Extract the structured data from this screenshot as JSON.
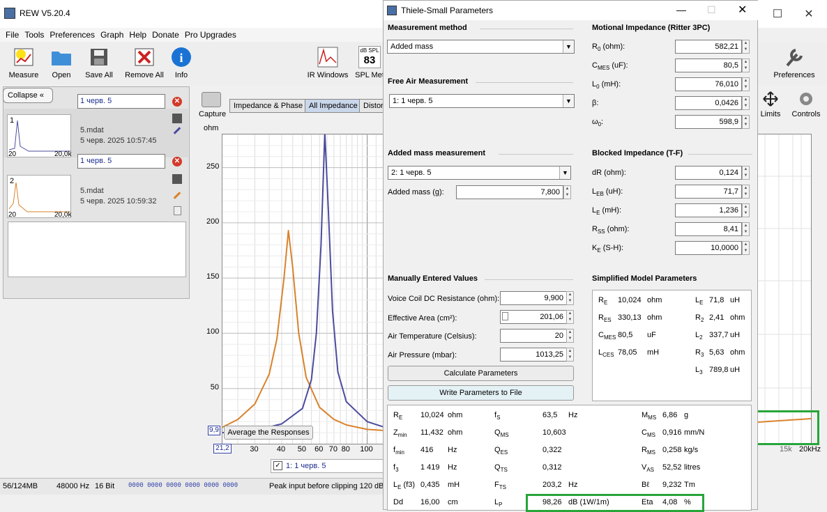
{
  "app": {
    "title": "REW V5.20.4",
    "menu": [
      "File",
      "Tools",
      "Preferences",
      "Graph",
      "Help",
      "Donate",
      "Pro Upgrades"
    ],
    "toolbar": {
      "measure": "Measure",
      "open": "Open",
      "save_all": "Save All",
      "remove_all": "Remove All",
      "info": "Info",
      "ir_windows": "IR Windows",
      "spl_meter": "SPL Met",
      "spl_meter_top": "dB SPL",
      "spl_meter_value": "83",
      "preferences": "Preferences",
      "limits": "Limits",
      "controls": "Controls"
    },
    "collapse": "Collapse",
    "capture": "Capture",
    "unit": "ohm",
    "tabs": [
      "Impedance & Phase",
      "All Impedance",
      "Distor"
    ],
    "measurements": [
      {
        "index": "1",
        "name": "1 черв. 5",
        "file": "5.mdat",
        "date": "5 черв. 2025 10:57:45",
        "thumb_x_min": "20",
        "thumb_x_max": "20,0k"
      },
      {
        "index": "2",
        "name": "1 черв. 5",
        "file": "5.mdat",
        "date": "5 черв. 2025 10:59:32",
        "thumb_x_min": "20",
        "thumb_x_max": "20,0k"
      }
    ],
    "average_btn": "Average the Responses",
    "legend_check": "1: 1 черв. 5",
    "graph_y_min": "9,9",
    "graph_x_min": "21,2",
    "right_x_ticks": [
      "15k",
      "20kHz"
    ],
    "status": {
      "mem": "56/124MB",
      "rate": "48000 Hz",
      "bits": "16 Bit",
      "bits_display": "0000 0000  0000 0000  0000 0000",
      "peak": "Peak input before clipping 120 dB"
    },
    "accent_orange": "#d9822b",
    "accent_blue": "#4b4b9e"
  },
  "chart_data": {
    "type": "line",
    "ylabel": "ohm",
    "yticks": [
      50,
      100,
      150,
      200,
      250
    ],
    "xticks": [
      "30",
      "40",
      "50",
      "60",
      "70",
      "80",
      "100"
    ],
    "ylim": [
      0,
      280
    ],
    "series": [
      {
        "color": "#d9822b",
        "x": [
          21.2,
          25,
          30,
          35,
          38,
          41,
          43,
          45,
          48,
          52,
          60,
          70,
          80,
          100,
          120
        ],
        "values": [
          15,
          22,
          36,
          63,
          95,
          150,
          193,
          160,
          100,
          60,
          33,
          22,
          17,
          13,
          12
        ]
      },
      {
        "color": "#4b4b9e",
        "x": [
          21.2,
          30,
          40,
          50,
          55,
          58,
          61,
          63.5,
          66,
          69,
          73,
          80,
          100,
          120
        ],
        "values": [
          10,
          12,
          18,
          32,
          58,
          100,
          180,
          282,
          210,
          120,
          65,
          38,
          20,
          15
        ]
      }
    ]
  },
  "dialog": {
    "title": "Thiele-Small Parameters",
    "measurement_method_label": "Measurement method",
    "measurement_method": "Added mass",
    "free_air_label": "Free Air Measurement",
    "free_air": "1: 1 черв. 5",
    "added_mass_meas_label": "Added mass measurement",
    "added_mass_meas": "2: 1 черв. 5",
    "added_mass_label": "Added mass (g):",
    "added_mass": "7,800",
    "motional_label": "Motional Impedance (Ritter 3PC)",
    "motional": [
      {
        "name": "R",
        "sub": "0",
        "unit": " (ohm):",
        "value": "582,21"
      },
      {
        "name": "C",
        "sub": "MES",
        "unit": " (uF):",
        "value": "80,5"
      },
      {
        "name": "L",
        "sub": "0",
        "unit": " (mH):",
        "value": "76,010"
      },
      {
        "name": "β",
        "sub": "",
        "unit": ":",
        "value": "0,0426"
      },
      {
        "name": "ω",
        "sub": "0",
        "unit": ":",
        "value": "598,9"
      }
    ],
    "blocked_label": "Blocked Impedance (T-F)",
    "blocked": [
      {
        "name": "dR",
        "sub": "",
        "unit": " (ohm):",
        "value": "0,124"
      },
      {
        "name": "L",
        "sub": "EB",
        "unit": " (uH):",
        "value": "71,7"
      },
      {
        "name": "L",
        "sub": "E",
        "unit": " (mH):",
        "value": "1,236"
      },
      {
        "name": "R",
        "sub": "SS",
        "unit": " (ohm):",
        "value": "8,41"
      },
      {
        "name": "K",
        "sub": "E",
        "unit": " (S-H):",
        "value": "10,0000"
      }
    ],
    "manual_label": "Manually Entered Values",
    "manual": [
      {
        "label": "Voice Coil DC Resistance (ohm):",
        "value": "9,900"
      },
      {
        "label": "Effective Area (cm²):",
        "value": "201,06"
      },
      {
        "label": "Air Temperature (Celsius):",
        "value": "20"
      },
      {
        "label": "Air Pressure (mbar):",
        "value": "1013,25"
      }
    ],
    "calc_btn": "Calculate Parameters",
    "write_btn": "Write Parameters to File",
    "simplified_label": "Simplified Model Parameters",
    "simplified_left": [
      {
        "name": "R",
        "sub": "E",
        "value": "10,024",
        "unit": "ohm"
      },
      {
        "name": "R",
        "sub": "ES",
        "value": "330,13",
        "unit": "ohm"
      },
      {
        "name": "C",
        "sub": "MES",
        "value": "80,5",
        "unit": "uF"
      },
      {
        "name": "L",
        "sub": "CES",
        "value": "78,05",
        "unit": "mH"
      }
    ],
    "simplified_right": [
      {
        "name": "L",
        "sub": "E",
        "value": "71,8",
        "unit": "uH"
      },
      {
        "name": "R",
        "sub": "2",
        "value": "2,41",
        "unit": "ohm"
      },
      {
        "name": "L",
        "sub": "2",
        "value": "337,7",
        "unit": "uH"
      },
      {
        "name": "R",
        "sub": "3",
        "value": "5,63",
        "unit": "ohm"
      },
      {
        "name": "L",
        "sub": "3",
        "value": "789,8",
        "unit": "uH"
      }
    ],
    "results": [
      [
        {
          "name": "R",
          "sub": "E",
          "value": "10,024",
          "unit": "ohm"
        },
        {
          "name": "f",
          "sub": "S",
          "value": "63,5",
          "unit": "Hz"
        },
        {
          "name": "M",
          "sub": "MS",
          "value": "6,86",
          "unit": "g"
        }
      ],
      [
        {
          "name": "Z",
          "sub": "min",
          "value": "11,432",
          "unit": "ohm"
        },
        {
          "name": "Q",
          "sub": "MS",
          "value": "10,603",
          "unit": ""
        },
        {
          "name": "C",
          "sub": "MS",
          "value": "0,916",
          "unit": "mm/N"
        }
      ],
      [
        {
          "name": "f",
          "sub": "min",
          "value": "416",
          "unit": "Hz"
        },
        {
          "name": "Q",
          "sub": "ES",
          "value": "0,322",
          "unit": ""
        },
        {
          "name": "R",
          "sub": "MS",
          "value": "0,258",
          "unit": "kg/s"
        }
      ],
      [
        {
          "name": "f",
          "sub": "3",
          "value": "1 419",
          "unit": "Hz"
        },
        {
          "name": "Q",
          "sub": "TS",
          "value": "0,312",
          "unit": ""
        },
        {
          "name": "V",
          "sub": "AS",
          "value": "52,52",
          "unit": "litres"
        }
      ],
      [
        {
          "name": "L",
          "sub": "E",
          "extra": " (f3)",
          "value": "0,435",
          "unit": "mH"
        },
        {
          "name": "F",
          "sub": "TS",
          "value": "203,2",
          "unit": "Hz"
        },
        {
          "name": "Bℓ",
          "sub": "",
          "value": "9,232",
          "unit": "Tm"
        }
      ],
      [
        {
          "name": "Dd",
          "sub": "",
          "value": "16,00",
          "unit": "cm"
        },
        {
          "name": "L",
          "sub": "P",
          "value": "98,26",
          "unit": "dB (1W/1m)"
        },
        {
          "name": "Eta",
          "sub": "",
          "value": "4,08",
          "unit": "%"
        }
      ]
    ]
  }
}
